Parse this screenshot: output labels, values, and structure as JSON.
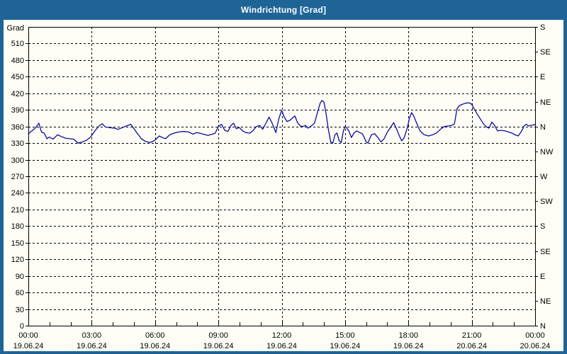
{
  "window": {
    "title": "Windrichtung [Grad]"
  },
  "colors": {
    "frame": "#1e6496",
    "title_text": "#ffffff",
    "plot_bg": "#fefef6",
    "grid": "#000000",
    "text": "#000000",
    "line": "#0a0aa0"
  },
  "chart_data": {
    "type": "line",
    "title": "Windrichtung [Grad]",
    "grid": "dashed",
    "y_left": {
      "label": "Grad",
      "min": 0,
      "max": 540,
      "tick_step": 30,
      "ticks": [
        0,
        30,
        60,
        90,
        120,
        150,
        180,
        210,
        240,
        270,
        300,
        330,
        360,
        390,
        420,
        450,
        480,
        510
      ]
    },
    "y_right": {
      "ticks": [
        {
          "value": 0,
          "label": "N"
        },
        {
          "value": 45,
          "label": "NE"
        },
        {
          "value": 90,
          "label": "E"
        },
        {
          "value": 135,
          "label": "SE"
        },
        {
          "value": 180,
          "label": "S"
        },
        {
          "value": 225,
          "label": "SW"
        },
        {
          "value": 270,
          "label": "W"
        },
        {
          "value": 315,
          "label": "NW"
        },
        {
          "value": 360,
          "label": "N"
        },
        {
          "value": 405,
          "label": "NE"
        },
        {
          "value": 450,
          "label": "E"
        },
        {
          "value": 495,
          "label": "SE"
        },
        {
          "value": 540,
          "label": "S"
        }
      ]
    },
    "x": {
      "range_hours": [
        0,
        24
      ],
      "minor_tick_hours": 1,
      "ticks": [
        {
          "hour": 0,
          "time": "00:00",
          "date": "19.06.24"
        },
        {
          "hour": 3,
          "time": "03:00",
          "date": "19.06.24"
        },
        {
          "hour": 6,
          "time": "06:00",
          "date": "19.06.24"
        },
        {
          "hour": 9,
          "time": "09:00",
          "date": "19.06.24"
        },
        {
          "hour": 12,
          "time": "12:00",
          "date": "19.06.24"
        },
        {
          "hour": 15,
          "time": "15:00",
          "date": "19.06.24"
        },
        {
          "hour": 18,
          "time": "18:00",
          "date": "19.06.24"
        },
        {
          "hour": 21,
          "time": "21:00",
          "date": "20.06.24"
        },
        {
          "hour": 24,
          "time": "00:00",
          "date": "20.06.24"
        }
      ]
    },
    "series": [
      {
        "name": "Windrichtung",
        "unit": "Grad",
        "color": "#0a0aa0",
        "points": [
          [
            0.0,
            347
          ],
          [
            0.2,
            353
          ],
          [
            0.35,
            358
          ],
          [
            0.5,
            366
          ],
          [
            0.62,
            350
          ],
          [
            0.75,
            348
          ],
          [
            0.88,
            338
          ],
          [
            1.0,
            341
          ],
          [
            1.17,
            337
          ],
          [
            1.38,
            345
          ],
          [
            1.55,
            342
          ],
          [
            1.75,
            339
          ],
          [
            1.95,
            338
          ],
          [
            2.15,
            337
          ],
          [
            2.35,
            330
          ],
          [
            2.55,
            332
          ],
          [
            2.75,
            335
          ],
          [
            2.95,
            341
          ],
          [
            3.15,
            352
          ],
          [
            3.35,
            361
          ],
          [
            3.5,
            365
          ],
          [
            3.65,
            359
          ],
          [
            3.85,
            358
          ],
          [
            4.05,
            357
          ],
          [
            4.25,
            355
          ],
          [
            4.45,
            358
          ],
          [
            4.65,
            361
          ],
          [
            4.85,
            364
          ],
          [
            5.0,
            356
          ],
          [
            5.15,
            348
          ],
          [
            5.35,
            338
          ],
          [
            5.55,
            333
          ],
          [
            5.75,
            331
          ],
          [
            5.9,
            333
          ],
          [
            6.05,
            337
          ],
          [
            6.2,
            343
          ],
          [
            6.35,
            340
          ],
          [
            6.5,
            338
          ],
          [
            6.7,
            345
          ],
          [
            6.9,
            348
          ],
          [
            7.1,
            350
          ],
          [
            7.35,
            351
          ],
          [
            7.6,
            350
          ],
          [
            7.8,
            346
          ],
          [
            7.95,
            349
          ],
          [
            8.1,
            348
          ],
          [
            8.3,
            346
          ],
          [
            8.5,
            344
          ],
          [
            8.7,
            346
          ],
          [
            8.85,
            348
          ],
          [
            9.0,
            360
          ],
          [
            9.15,
            364
          ],
          [
            9.3,
            353
          ],
          [
            9.45,
            351
          ],
          [
            9.6,
            362
          ],
          [
            9.72,
            366
          ],
          [
            9.85,
            356
          ],
          [
            10.0,
            358
          ],
          [
            10.15,
            352
          ],
          [
            10.3,
            349
          ],
          [
            10.5,
            348
          ],
          [
            10.65,
            353
          ],
          [
            10.8,
            360
          ],
          [
            10.95,
            362
          ],
          [
            11.1,
            355
          ],
          [
            11.25,
            366
          ],
          [
            11.4,
            377
          ],
          [
            11.52,
            368
          ],
          [
            11.62,
            359
          ],
          [
            11.72,
            349
          ],
          [
            11.87,
            375
          ],
          [
            12.0,
            389
          ],
          [
            12.12,
            377
          ],
          [
            12.25,
            369
          ],
          [
            12.38,
            371
          ],
          [
            12.5,
            375
          ],
          [
            12.62,
            379
          ],
          [
            12.75,
            367
          ],
          [
            12.88,
            361
          ],
          [
            13.0,
            360
          ],
          [
            13.12,
            362
          ],
          [
            13.25,
            357
          ],
          [
            13.4,
            361
          ],
          [
            13.55,
            366
          ],
          [
            13.7,
            386
          ],
          [
            13.82,
            402
          ],
          [
            13.9,
            407
          ],
          [
            14.0,
            404
          ],
          [
            14.1,
            383
          ],
          [
            14.2,
            357
          ],
          [
            14.32,
            332
          ],
          [
            14.42,
            330
          ],
          [
            14.52,
            345
          ],
          [
            14.62,
            348
          ],
          [
            14.72,
            334
          ],
          [
            14.82,
            331
          ],
          [
            14.92,
            352
          ],
          [
            15.0,
            360
          ],
          [
            15.08,
            357
          ],
          [
            15.18,
            352
          ],
          [
            15.3,
            340
          ],
          [
            15.42,
            348
          ],
          [
            15.55,
            352
          ],
          [
            15.7,
            349
          ],
          [
            15.82,
            347
          ],
          [
            16.0,
            332
          ],
          [
            16.08,
            330
          ],
          [
            16.25,
            345
          ],
          [
            16.4,
            347
          ],
          [
            16.55,
            340
          ],
          [
            16.7,
            332
          ],
          [
            16.85,
            338
          ],
          [
            17.0,
            350
          ],
          [
            17.15,
            358
          ],
          [
            17.3,
            367
          ],
          [
            17.42,
            357
          ],
          [
            17.55,
            345
          ],
          [
            17.68,
            334
          ],
          [
            17.8,
            340
          ],
          [
            17.95,
            358
          ],
          [
            18.05,
            375
          ],
          [
            18.15,
            385
          ],
          [
            18.25,
            379
          ],
          [
            18.4,
            365
          ],
          [
            18.55,
            352
          ],
          [
            18.75,
            345
          ],
          [
            18.95,
            343
          ],
          [
            19.15,
            345
          ],
          [
            19.35,
            349
          ],
          [
            19.55,
            356
          ],
          [
            19.7,
            360
          ],
          [
            19.9,
            361
          ],
          [
            20.05,
            362
          ],
          [
            20.18,
            365
          ],
          [
            20.3,
            392
          ],
          [
            20.42,
            398
          ],
          [
            20.55,
            400
          ],
          [
            20.7,
            402
          ],
          [
            20.85,
            403
          ],
          [
            20.98,
            401
          ],
          [
            21.1,
            393
          ],
          [
            21.25,
            383
          ],
          [
            21.4,
            374
          ],
          [
            21.55,
            365
          ],
          [
            21.7,
            359
          ],
          [
            21.82,
            357
          ],
          [
            21.95,
            368
          ],
          [
            22.08,
            362
          ],
          [
            22.22,
            352
          ],
          [
            22.4,
            353
          ],
          [
            22.58,
            352
          ],
          [
            22.75,
            350
          ],
          [
            22.9,
            348
          ],
          [
            23.05,
            345
          ],
          [
            23.2,
            343
          ],
          [
            23.35,
            351
          ],
          [
            23.48,
            361
          ],
          [
            23.58,
            364
          ],
          [
            23.68,
            361
          ],
          [
            23.82,
            362
          ],
          [
            23.95,
            363
          ],
          [
            24.0,
            364
          ]
        ]
      }
    ]
  }
}
